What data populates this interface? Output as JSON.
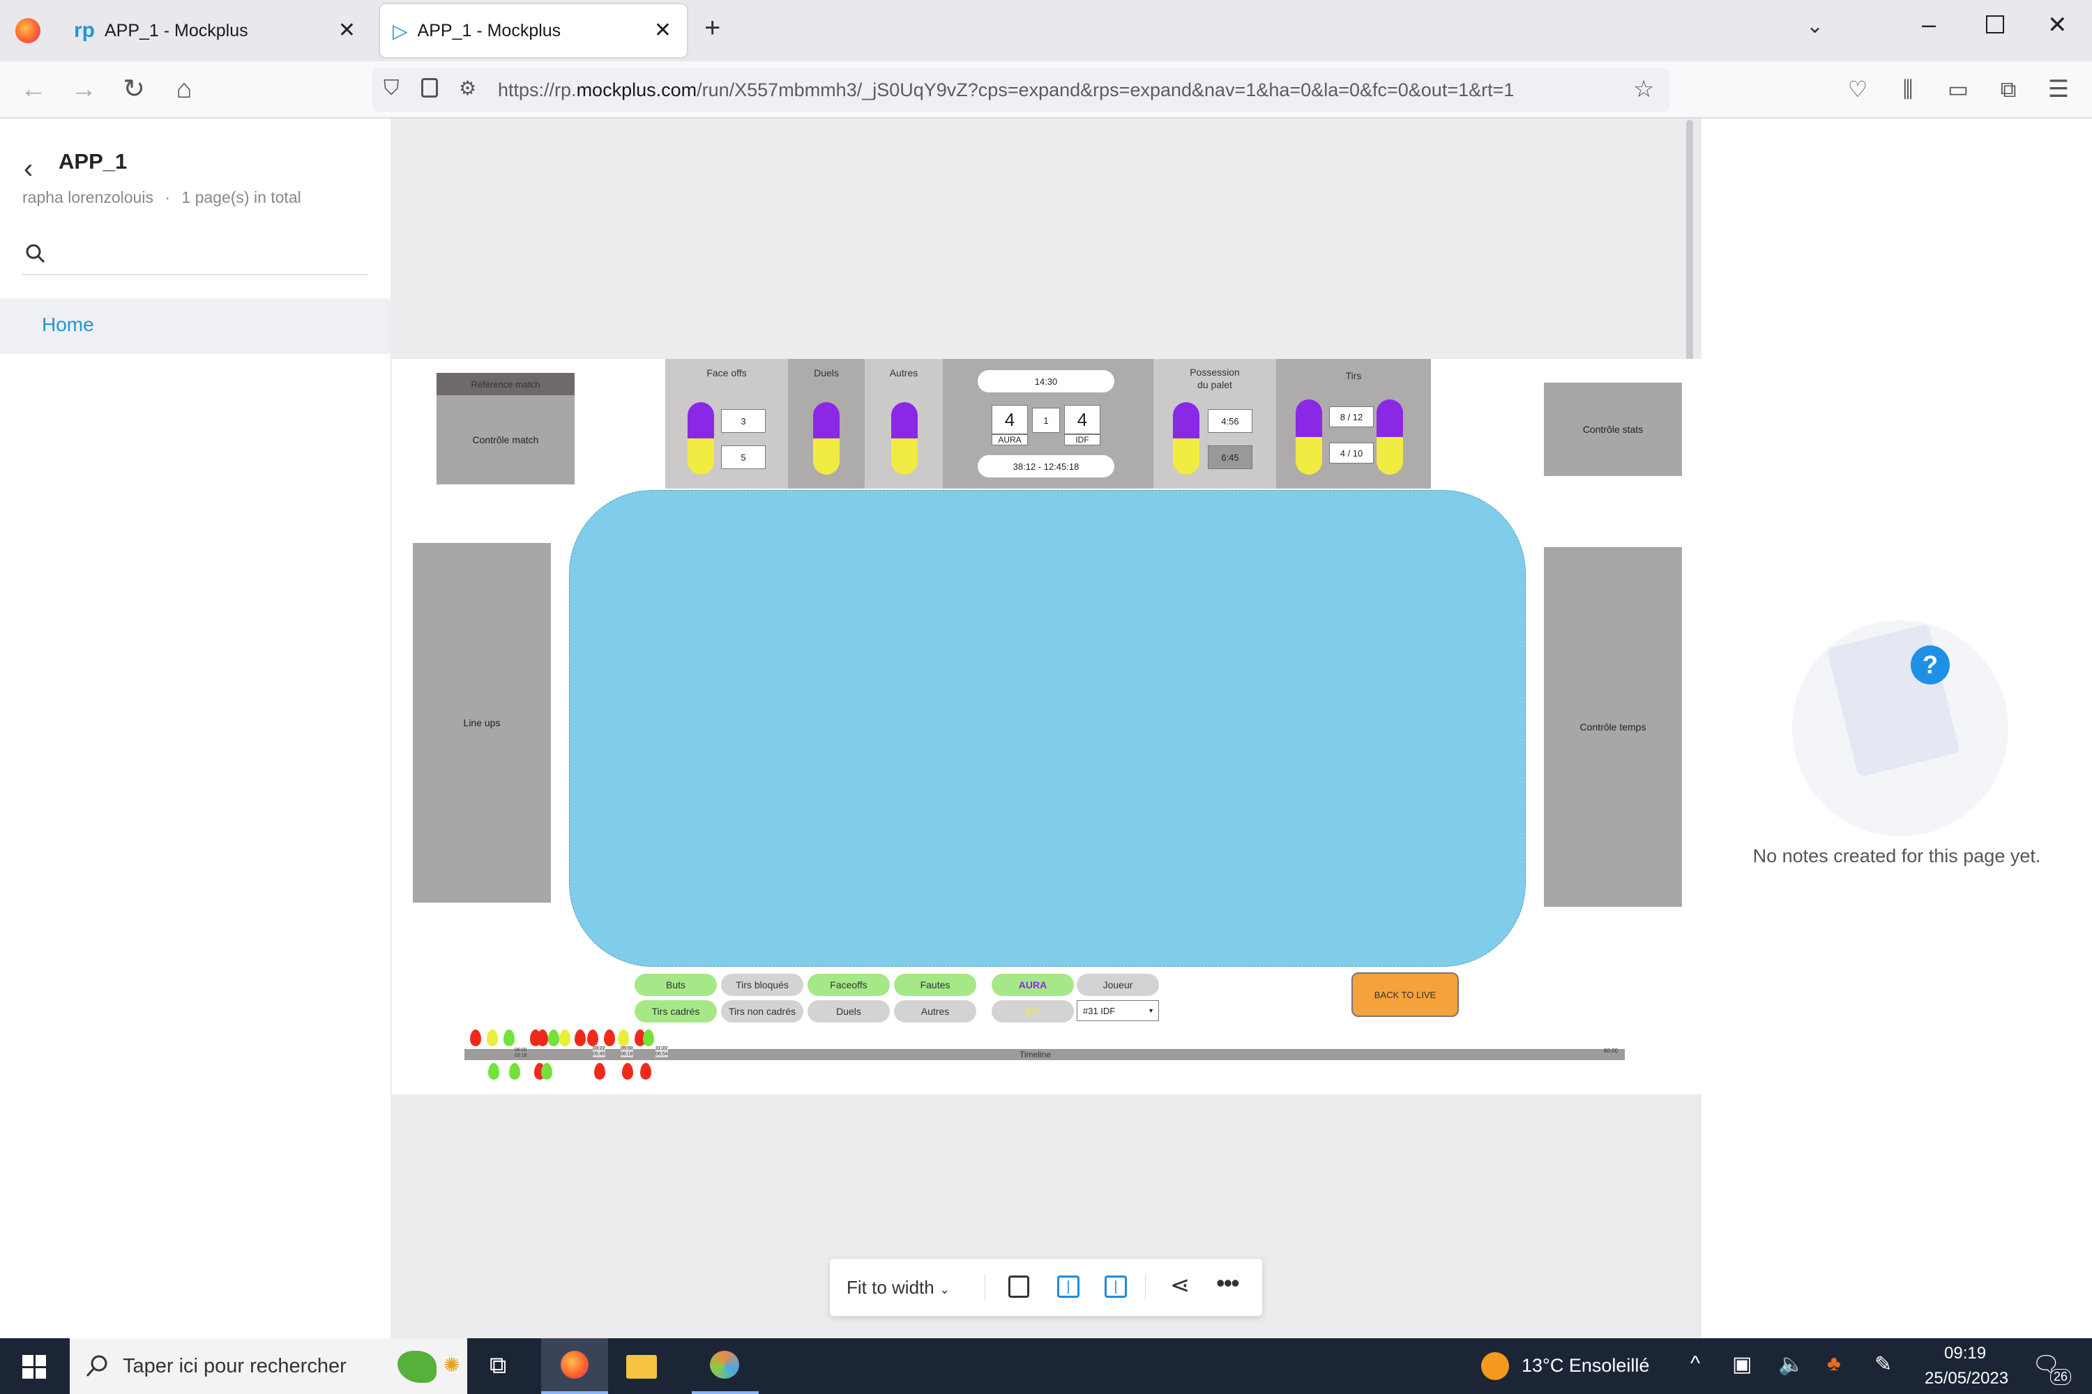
{
  "browser": {
    "tabs": [
      {
        "title": "APP_1 - Mockplus",
        "active": false
      },
      {
        "title": "APP_1 - Mockplus",
        "active": true
      }
    ],
    "url_prefix": "https://rp.",
    "url_domain": "mockplus.com",
    "url_rest": "/run/X557mbmmh3/_jS0UqY9vZ?cps=expand&rps=expand&nav=1&ha=0&la=0&fc=0&out=1&rt=1"
  },
  "sidebar": {
    "project_title": "APP_1",
    "author": "rapha lorenzolouis",
    "separator": "·",
    "page_count": "1 page(s) in total",
    "items": [
      {
        "label": "Home",
        "selected": true
      }
    ]
  },
  "mockup": {
    "ref_match": "Référence match",
    "controle_match": "Contrôle match",
    "face_offs": {
      "title": "Face offs",
      "home": "3",
      "away": "5"
    },
    "duels": {
      "title": "Duels"
    },
    "autres": {
      "title": "Autres"
    },
    "scoreboard": {
      "clock": "14:30",
      "home_score": "4",
      "period": "1",
      "away_score": "4",
      "home_team": "AURA",
      "away_team": "IDF",
      "time_range": "38:12 - 12:45:18"
    },
    "possession": {
      "title_line1": "Possession",
      "title_line2": "du palet",
      "home": "4:56",
      "away": "6:45"
    },
    "tirs": {
      "title": "Tirs",
      "home": "8 / 12",
      "away": "4 / 10"
    },
    "controle_stats": "Contrôle stats",
    "line_ups": "Line ups",
    "controle_temps": "Contrôle temps",
    "filters": [
      {
        "label": "Buts",
        "style": "green"
      },
      {
        "label": "Tirs bloqués",
        "style": "grey"
      },
      {
        "label": "Faceoffs",
        "style": "green"
      },
      {
        "label": "Fautes",
        "style": "green"
      },
      {
        "label": "Tirs cadrés",
        "style": "green"
      },
      {
        "label": "Tirs non cadrés",
        "style": "grey"
      },
      {
        "label": "Duels",
        "style": "grey"
      },
      {
        "label": "Autres",
        "style": "grey"
      }
    ],
    "team_toggle": {
      "aura": "AURA",
      "idf": "IDF"
    },
    "joueur_label": "Joueur",
    "player_select": "#31 IDF",
    "back_to_live": "BACK TO LIVE",
    "timeline_label": "Timeline",
    "timeline_end": "60:00",
    "timeline_ticks": [
      "06:00\n02:18",
      "03:22\n05:45",
      "05:00\n06:18",
      "11:22\n06:54"
    ]
  },
  "notes": {
    "empty_text": "No notes created for this page yet."
  },
  "viewbar": {
    "fit_label": "Fit to width"
  },
  "taskbar": {
    "search_placeholder": "Taper ici pour rechercher",
    "weather": "13°C  Ensoleillé",
    "time": "09:19",
    "date": "25/05/2023",
    "notif_count": "26"
  },
  "colors": {
    "rink": "#7fcdea",
    "gray_panel": "#a9a6a6",
    "purple": "#8a28e6",
    "yellow": "#f0ec42",
    "green_pill": "#a6e887",
    "orange": "#f4a23a",
    "link": "#2196d3"
  }
}
